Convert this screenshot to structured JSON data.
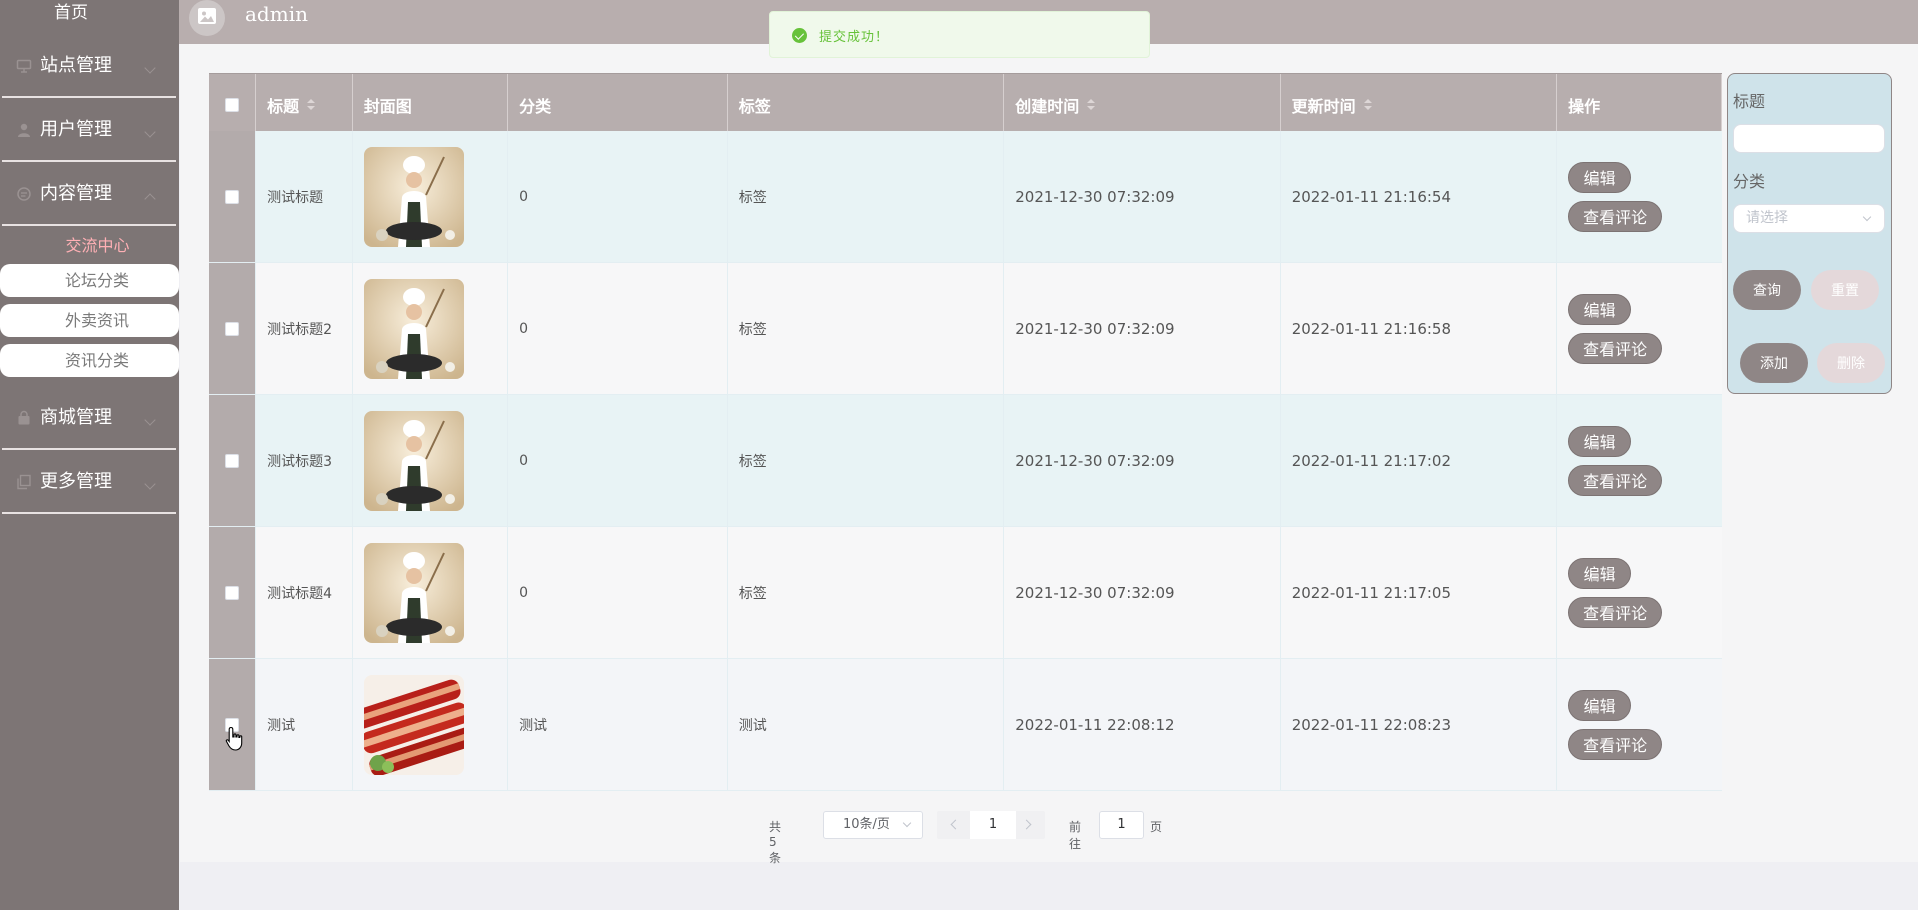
{
  "sidebar": {
    "home": "首页",
    "groups": [
      {
        "label": "站点管理",
        "icon": "monitor-icon"
      },
      {
        "label": "用户管理",
        "icon": "user-icon"
      },
      {
        "label": "内容管理",
        "icon": "chat-icon"
      },
      {
        "label": "商城管理",
        "icon": "bag-icon"
      },
      {
        "label": "更多管理",
        "icon": "copy-icon"
      }
    ],
    "submenu_header": "交流中心",
    "submenu_items": [
      "论坛分类",
      "外卖资讯",
      "资讯分类"
    ]
  },
  "header": {
    "username": "admin"
  },
  "toast": {
    "message": "提交成功！"
  },
  "table": {
    "headers": [
      "标题",
      "封面图",
      "分类",
      "标签",
      "创建时间",
      "更新时间",
      "操作"
    ],
    "rows": [
      {
        "title": "测试标题",
        "image": "chef",
        "category": "0",
        "tag": "标签",
        "created": "2021-12-30 07:32:09",
        "updated": "2022-01-11 21:16:54"
      },
      {
        "title": "测试标题2",
        "image": "chef",
        "category": "0",
        "tag": "标签",
        "created": "2021-12-30 07:32:09",
        "updated": "2022-01-11 21:16:58"
      },
      {
        "title": "测试标题3",
        "image": "chef",
        "category": "0",
        "tag": "标签",
        "created": "2021-12-30 07:32:09",
        "updated": "2022-01-11 21:17:02"
      },
      {
        "title": "测试标题4",
        "image": "chef",
        "category": "0",
        "tag": "标签",
        "created": "2021-12-30 07:32:09",
        "updated": "2022-01-11 21:17:05"
      },
      {
        "title": "测试",
        "image": "meat",
        "category": "测试",
        "tag": "测试",
        "created": "2022-01-11 22:08:12",
        "updated": "2022-01-11 22:08:23"
      }
    ],
    "edit_label": "编辑",
    "view_label": "查看评论"
  },
  "pagination": {
    "total": "共 5 条",
    "page_size": "10条/页",
    "current_page": "1",
    "goto_label": "前往",
    "goto_value": "1",
    "page_suffix": "页"
  },
  "search": {
    "title_label": "标题",
    "category_label": "分类",
    "category_placeholder": "请选择",
    "query_label": "查询",
    "reset_label": "重置",
    "add_label": "添加",
    "delete_label": "删除"
  },
  "colors": {
    "sidebar_bg": "#7d7575",
    "header_bg": "#b8aeae",
    "table_header_bg": "#b7aeae",
    "row_alt_bg": "#e8f3f5",
    "button_bg": "#8f8686",
    "success": "#67c23a",
    "active_submenu": "#ffb0b5"
  }
}
